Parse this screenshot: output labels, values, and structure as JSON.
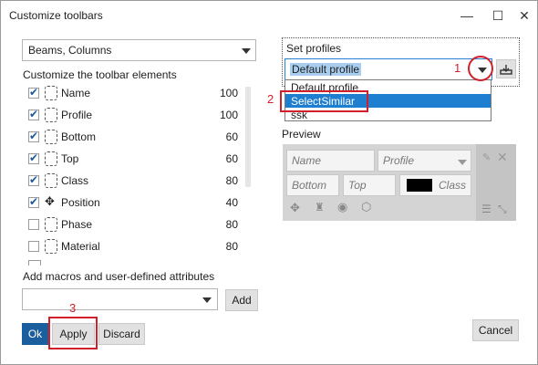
{
  "window": {
    "title": "Customize toolbars",
    "minimize_icon": "—",
    "maximize_icon": "☐",
    "close_icon": "✕"
  },
  "left": {
    "category_select": "Beams, Columns",
    "section_label": "Customize the toolbar elements",
    "items": [
      {
        "label": "Name",
        "value": "100",
        "checked": true
      },
      {
        "label": "Profile",
        "value": "100",
        "checked": true
      },
      {
        "label": "Bottom",
        "value": "60",
        "checked": true
      },
      {
        "label": "Top",
        "value": "60",
        "checked": true
      },
      {
        "label": "Class",
        "value": "80",
        "checked": true
      },
      {
        "label": "Position",
        "value": "40",
        "checked": true
      },
      {
        "label": "Phase",
        "value": "80",
        "checked": false
      },
      {
        "label": "Material",
        "value": "80",
        "checked": false
      }
    ],
    "macros_label": "Add macros and user-defined attributes",
    "macros_value": "",
    "add_label": "Add"
  },
  "profiles": {
    "label": "Set profiles",
    "selected": "Default profile",
    "options": [
      "Default profile",
      "SelectSimilar",
      "ssk"
    ]
  },
  "preview": {
    "label": "Preview",
    "name_field": "Name",
    "profile_field": "Profile",
    "bottom_field": "Bottom",
    "top_field": "Top",
    "class_field": "Class"
  },
  "buttons": {
    "ok": "Ok",
    "apply": "Apply",
    "discard": "Discard",
    "cancel": "Cancel"
  },
  "annotations": {
    "step1": "1",
    "step2": "2",
    "step3": "3",
    "highlight_color": "#d0202a"
  },
  "colors": {
    "selection": "#1e7fd0",
    "ok_button": "#1b5e9e"
  }
}
